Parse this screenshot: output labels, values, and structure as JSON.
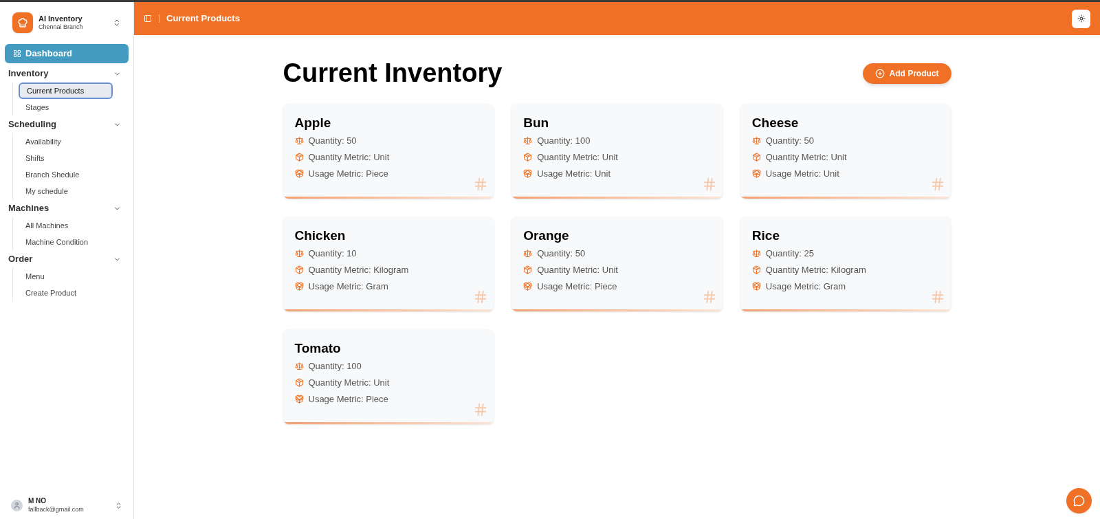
{
  "brand": {
    "name": "AI Inventory",
    "branch": "Chennai Branch"
  },
  "sidebar": {
    "dashboard": {
      "label": "Dashboard",
      "selected": true
    },
    "groups": [
      {
        "label": "Inventory",
        "expanded": true,
        "items": [
          {
            "label": "Current Products",
            "selected": true
          },
          {
            "label": "Stages",
            "selected": false
          }
        ]
      },
      {
        "label": "Scheduling",
        "expanded": true,
        "items": [
          {
            "label": "Availability",
            "selected": false
          },
          {
            "label": "Shifts",
            "selected": false
          },
          {
            "label": "Branch Shedule",
            "selected": false
          },
          {
            "label": "My schedule",
            "selected": false
          }
        ]
      },
      {
        "label": "Machines",
        "expanded": true,
        "items": [
          {
            "label": "All Machines",
            "selected": false
          },
          {
            "label": "Machine Condition",
            "selected": false
          }
        ]
      },
      {
        "label": "Order",
        "expanded": true,
        "items": [
          {
            "label": "Menu",
            "selected": false
          },
          {
            "label": "Create Product",
            "selected": false
          }
        ]
      }
    ],
    "user": {
      "name": "M NO",
      "email": "fallback@gmail.com"
    }
  },
  "header": {
    "breadcrumb": "Current Products"
  },
  "page": {
    "title": "Current Inventory",
    "add_button": "Add Product",
    "products": [
      {
        "name": "Apple",
        "quantity": "Quantity: 50",
        "quantity_metric": "Quantity Metric: Unit",
        "usage_metric": "Usage Metric: Piece"
      },
      {
        "name": "Bun",
        "quantity": "Quantity: 100",
        "quantity_metric": "Quantity Metric: Unit",
        "usage_metric": "Usage Metric: Unit"
      },
      {
        "name": "Cheese",
        "quantity": "Quantity: 50",
        "quantity_metric": "Quantity Metric: Unit",
        "usage_metric": "Usage Metric: Unit"
      },
      {
        "name": "Chicken",
        "quantity": "Quantity: 10",
        "quantity_metric": "Quantity Metric: Kilogram",
        "usage_metric": "Usage Metric: Gram"
      },
      {
        "name": "Orange",
        "quantity": "Quantity: 50",
        "quantity_metric": "Quantity Metric: Unit",
        "usage_metric": "Usage Metric: Piece"
      },
      {
        "name": "Rice",
        "quantity": "Quantity: 25",
        "quantity_metric": "Quantity Metric: Kilogram",
        "usage_metric": "Usage Metric: Gram"
      },
      {
        "name": "Tomato",
        "quantity": "Quantity: 100",
        "quantity_metric": "Quantity Metric: Unit",
        "usage_metric": "Usage Metric: Piece"
      }
    ]
  }
}
